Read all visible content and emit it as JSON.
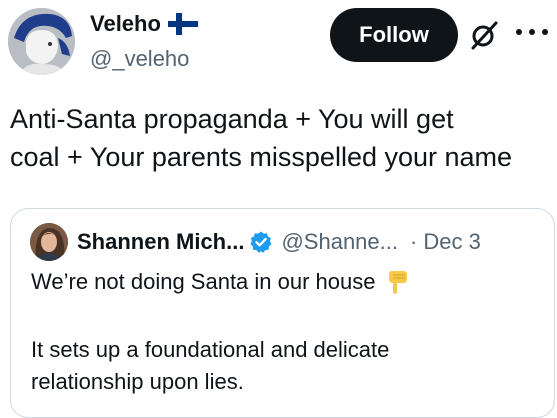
{
  "author": {
    "display_name": "Veleho",
    "handle": "@_veleho",
    "flag": "finland-flag"
  },
  "actions": {
    "follow_label": "Follow",
    "grok_icon": "grok-icon",
    "more_icon": "more-icon"
  },
  "tweet": {
    "line1": "Anti-Santa propaganda + You will get",
    "line2": "coal + Your parents misspelled your name"
  },
  "quoted": {
    "display_name": "Shannen Mich...",
    "handle": "@Shanne...",
    "separator": "·",
    "date": "Dec 3",
    "verified_icon": "verified-badge-icon",
    "line1": "We’re not doing Santa in our house",
    "emoji": "backhand-index-pointing-down-icon",
    "line2": "It sets up a foundational and delicate",
    "line3": "relationship upon lies."
  },
  "colors": {
    "text": "#0f1419",
    "secondary": "#536471",
    "border": "#cfd9de",
    "verified": "#1d9bf0",
    "follow_bg": "#0f1419",
    "flag_blue": "#003580"
  }
}
